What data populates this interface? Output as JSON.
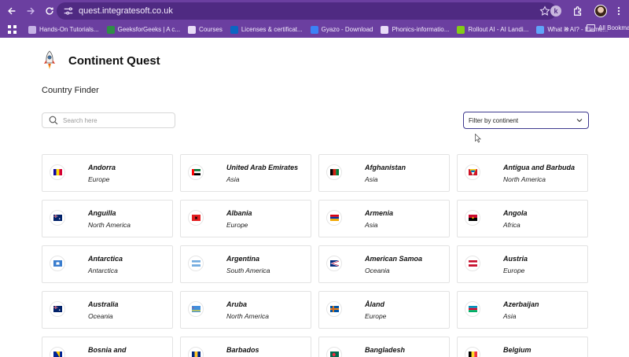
{
  "browser": {
    "url": "quest.integratesoft.co.uk",
    "bookmarks": [
      {
        "label": "Hands-On Tutorials...",
        "color": "#c7b3e6"
      },
      {
        "label": "GeeksforGeeks | A c...",
        "color": "#2f8d46"
      },
      {
        "label": "Courses",
        "color": "#e9dcf7"
      },
      {
        "label": "Licenses & certificat...",
        "color": "#0a66c2"
      },
      {
        "label": "Gyazo - Download",
        "color": "#3b82f6"
      },
      {
        "label": "Phonics-informatio...",
        "color": "#e9dcf7"
      },
      {
        "label": "Rollout AI - AI Landi...",
        "color": "#84cc16"
      },
      {
        "label": "What is AI? - Eleme...",
        "color": "#60a5fa"
      }
    ],
    "more_label": "»",
    "all_bookmarks_label": "All Bookmarks",
    "extension_letter": "k"
  },
  "app": {
    "title": "Continent Quest",
    "subtitle": "Country Finder"
  },
  "search": {
    "placeholder": "Search here"
  },
  "filter": {
    "label": "Filter by continent"
  },
  "countries": [
    {
      "name": "Andorra",
      "continent": "Europe",
      "flag": [
        "#10069f",
        "#fedf00",
        "#d50032"
      ],
      "flag_layout": "vertical"
    },
    {
      "name": "United Arab Emirates",
      "continent": "Asia",
      "flag": [
        "#00732f",
        "#ffffff",
        "#000000"
      ],
      "flag_layout": "uae"
    },
    {
      "name": "Afghanistan",
      "continent": "Asia",
      "flag": [
        "#000000",
        "#d32011",
        "#007a36"
      ],
      "flag_layout": "vertical"
    },
    {
      "name": "Antigua and Barbuda",
      "continent": "North America",
      "flag": [
        "#ce1126",
        "#000000",
        "#fcd116"
      ],
      "flag_layout": "antigua"
    },
    {
      "name": "Anguilla",
      "continent": "North America",
      "flag": [
        "#012169",
        "#ffffff",
        "#c8102e"
      ],
      "flag_layout": "ensign"
    },
    {
      "name": "Albania",
      "continent": "Europe",
      "flag": [
        "#e41e20",
        "#000000",
        "#e41e20"
      ],
      "flag_layout": "albania"
    },
    {
      "name": "Armenia",
      "continent": "Asia",
      "flag": [
        "#d90012",
        "#0033a0",
        "#f2a800"
      ],
      "flag_layout": "horizontal"
    },
    {
      "name": "Angola",
      "continent": "Africa",
      "flag": [
        "#cc092f",
        "#000000",
        "#ffcb00"
      ],
      "flag_layout": "angola"
    },
    {
      "name": "Antarctica",
      "continent": "Antarctica",
      "flag": [
        "#3a7dce",
        "#ffffff",
        "#3a7dce"
      ],
      "flag_layout": "antarctica"
    },
    {
      "name": "Argentina",
      "continent": "South America",
      "flag": [
        "#74acdf",
        "#ffffff",
        "#74acdf"
      ],
      "flag_layout": "horizontal"
    },
    {
      "name": "American Samoa",
      "continent": "Oceania",
      "flag": [
        "#002b7f",
        "#ffffff",
        "#bf0d3e"
      ],
      "flag_layout": "samoa"
    },
    {
      "name": "Austria",
      "continent": "Europe",
      "flag": [
        "#c8102e",
        "#ffffff",
        "#c8102e"
      ],
      "flag_layout": "horizontal"
    },
    {
      "name": "Australia",
      "continent": "Oceania",
      "flag": [
        "#012169",
        "#ffffff",
        "#e4002b"
      ],
      "flag_layout": "ensign"
    },
    {
      "name": "Aruba",
      "continent": "North America",
      "flag": [
        "#418fde",
        "#fbe122",
        "#418fde"
      ],
      "flag_layout": "aruba"
    },
    {
      "name": "Åland",
      "continent": "Europe",
      "flag": [
        "#0053a5",
        "#ffce00",
        "#d21034"
      ],
      "flag_layout": "nordic"
    },
    {
      "name": "Azerbaijan",
      "continent": "Asia",
      "flag": [
        "#0092bc",
        "#e4002b",
        "#00af66"
      ],
      "flag_layout": "horizontal"
    },
    {
      "name": "Bosnia and",
      "continent": "",
      "flag": [
        "#002395",
        "#fecb00",
        "#ffffff"
      ],
      "flag_layout": "bosnia"
    },
    {
      "name": "Barbados",
      "continent": "",
      "flag": [
        "#00267f",
        "#ffc726",
        "#00267f"
      ],
      "flag_layout": "vertical"
    },
    {
      "name": "Bangladesh",
      "continent": "",
      "flag": [
        "#006a4e",
        "#f42a41",
        "#006a4e"
      ],
      "flag_layout": "bangladesh"
    },
    {
      "name": "Belgium",
      "continent": "",
      "flag": [
        "#000000",
        "#fdda24",
        "#ef3340"
      ],
      "flag_layout": "vertical"
    }
  ]
}
